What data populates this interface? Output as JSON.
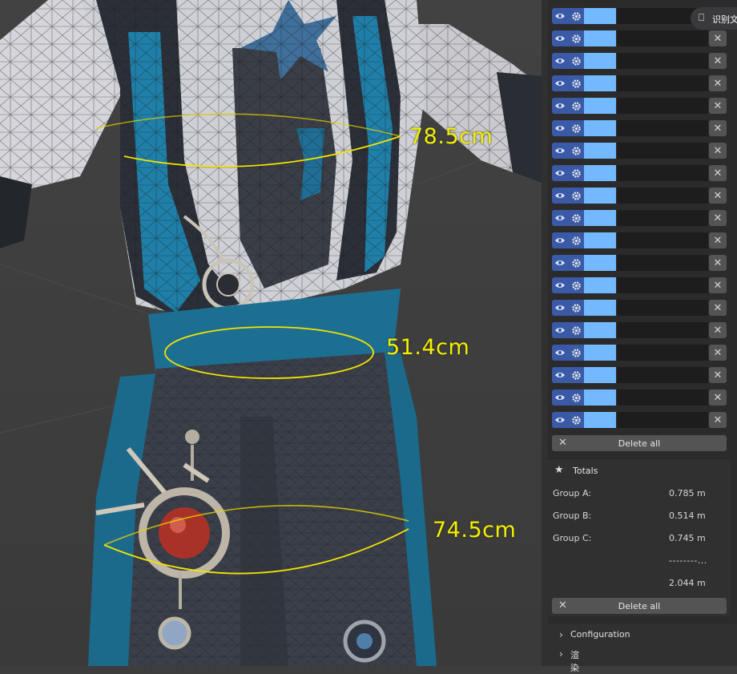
{
  "viewport": {
    "measurements": [
      {
        "label": "78.5cm"
      },
      {
        "label": "51.4cm"
      },
      {
        "label": "74.5cm"
      }
    ]
  },
  "sidebar": {
    "list_rows": 19,
    "row_icons": [
      "eye-icon",
      "gear-icon",
      "close-icon"
    ],
    "row_color": "#73b9ff",
    "delete_all_label": "Delete all",
    "totals": {
      "title": "Totals",
      "rows": [
        {
          "key": "Group A:",
          "value": "0.785 m"
        },
        {
          "key": "Group B:",
          "value": "0.514 m"
        },
        {
          "key": "Group C:",
          "value": "0.745 m"
        }
      ],
      "separator": "--------...",
      "sum": "2.044 m",
      "delete_all_label": "Delete all"
    },
    "sections": [
      {
        "label": "Configuration"
      },
      {
        "label": "渲染"
      }
    ]
  },
  "overlay": {
    "ocr_label": "识别文"
  },
  "colors": {
    "measure": "#f4f000",
    "accent_blue": "#3a5aa7",
    "swatch": "#73b9ff"
  }
}
